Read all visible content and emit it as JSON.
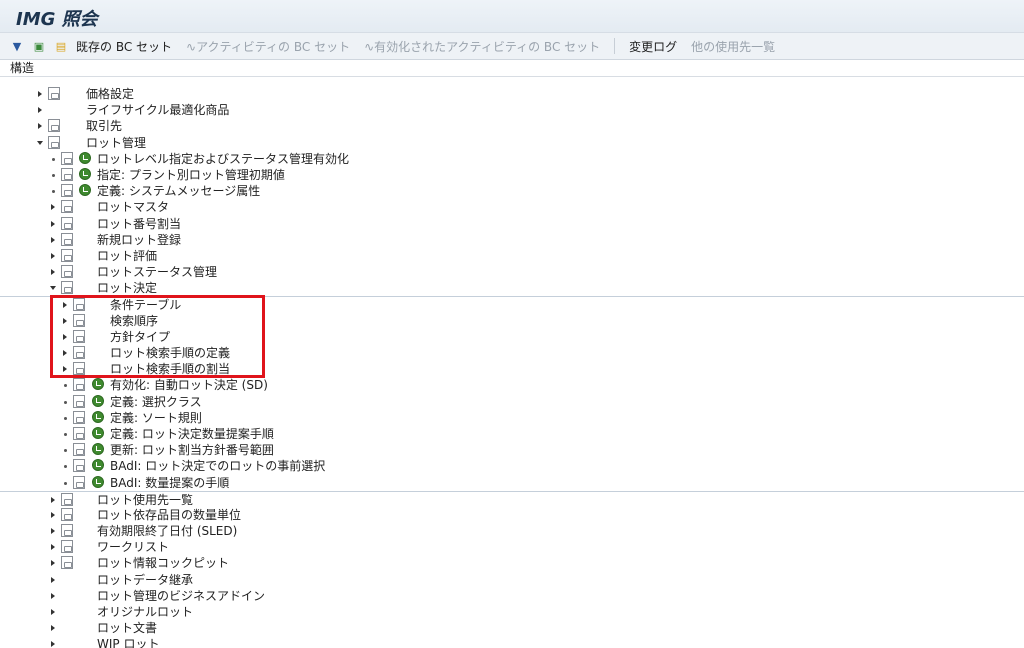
{
  "window": {
    "title": "IMG 照会"
  },
  "toolbar": {
    "buttons": [
      {
        "label": "既存の BC セット",
        "enabled": true
      },
      {
        "label": "アクティビティの BC セット",
        "enabled": false
      },
      {
        "label": "有効化されたアクティビティの BC セット",
        "enabled": false
      },
      {
        "label": "変更ログ",
        "enabled": true
      },
      {
        "label": "他の使用先一覧",
        "enabled": false
      }
    ]
  },
  "structure": {
    "header": "構造"
  },
  "tree": [
    {
      "label": "価格設定"
    },
    {
      "label": "ライフサイクル最適化商品"
    },
    {
      "label": "取引先"
    },
    {
      "label": "ロット管理"
    },
    {
      "label": "ロットレベル指定およびステータス管理有効化"
    },
    {
      "label": "指定: プラント別ロット管理初期値"
    },
    {
      "label": "定義: システムメッセージ属性"
    },
    {
      "label": "ロットマスタ"
    },
    {
      "label": "ロット番号割当"
    },
    {
      "label": "新規ロット登録"
    },
    {
      "label": "ロット評価"
    },
    {
      "label": "ロットステータス管理"
    },
    {
      "label": "ロット決定"
    },
    {
      "label": "条件テーブル"
    },
    {
      "label": "検索順序"
    },
    {
      "label": "方針タイプ"
    },
    {
      "label": "ロット検索手順の定義"
    },
    {
      "label": "ロット検索手順の割当"
    },
    {
      "label": "有効化: 自動ロット決定 (SD)"
    },
    {
      "label": "定義: 選択クラス"
    },
    {
      "label": "定義: ソート規則"
    },
    {
      "label": "定義: ロット決定数量提案手順"
    },
    {
      "label": "更新: ロット割当方針番号範囲"
    },
    {
      "label": "BAdI: ロット決定でのロットの事前選択"
    },
    {
      "label": "BAdI: 数量提案の手順"
    },
    {
      "label": "ロット使用先一覧"
    },
    {
      "label": "ロット依存品目の数量単位"
    },
    {
      "label": "有効期限終了日付 (SLED)"
    },
    {
      "label": "ワークリスト"
    },
    {
      "label": "ロット情報コックピット"
    },
    {
      "label": "ロットデータ継承"
    },
    {
      "label": "ロット管理のビジネスアドイン"
    },
    {
      "label": "オリジナルロット"
    },
    {
      "label": "ロット文書"
    },
    {
      "label": "WIP ロット"
    }
  ]
}
